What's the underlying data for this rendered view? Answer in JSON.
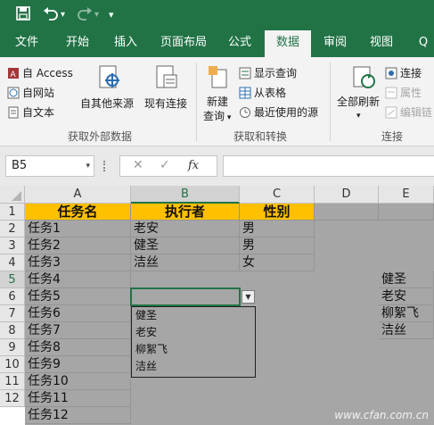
{
  "qat": {
    "save_icon": "save-icon",
    "undo_icon": "undo-icon",
    "redo_icon": "redo-icon",
    "customize_icon": "customize-icon"
  },
  "tabs": [
    {
      "label": "文件"
    },
    {
      "label": "开始"
    },
    {
      "label": "插入"
    },
    {
      "label": "页面布局"
    },
    {
      "label": "公式"
    },
    {
      "label": "数据"
    },
    {
      "label": "审阅"
    },
    {
      "label": "视图"
    },
    {
      "label": "Q"
    }
  ],
  "ribbon": {
    "external": {
      "from_access": "自 Access",
      "from_web": "自网站",
      "from_text": "自文本",
      "from_other": "自其他来源",
      "existing": "现有连接",
      "group_label": "获取外部数据"
    },
    "transform": {
      "new_query_line1": "新建",
      "new_query_line2": "查询",
      "show_queries": "显示查询",
      "from_table": "从表格",
      "recent_sources": "最近使用的源",
      "group_label": "获取和转换"
    },
    "connections": {
      "refresh_all": "全部刷新",
      "connections": "连接",
      "properties": "属性",
      "edit_links": "编辑链",
      "group_label": "连接"
    }
  },
  "formula_bar": {
    "name_box": "B5",
    "fx_label": "fx",
    "value": ""
  },
  "columns": [
    "A",
    "B",
    "C",
    "D",
    "E"
  ],
  "rows": [
    "1",
    "2",
    "3",
    "4",
    "5",
    "6",
    "7",
    "8",
    "9",
    "10",
    "11",
    "12"
  ],
  "table": {
    "headers": [
      "任务名",
      "执行者",
      "性别"
    ],
    "col_a": [
      "任务1",
      "任务2",
      "任务3",
      "任务4",
      "任务5",
      "任务6",
      "任务7",
      "任务8",
      "任务9",
      "任务10",
      "任务11",
      "任务12"
    ],
    "col_b": [
      "老安",
      "健圣",
      "洁丝"
    ],
    "col_c": [
      "男",
      "男",
      "女"
    ],
    "col_e": [
      "健圣",
      "老安",
      "柳絮飞",
      "洁丝"
    ]
  },
  "dropdown": {
    "options": [
      "健圣",
      "老安",
      "柳絮飞",
      "洁丝"
    ]
  },
  "watermark": "www.cfan.com.cn"
}
